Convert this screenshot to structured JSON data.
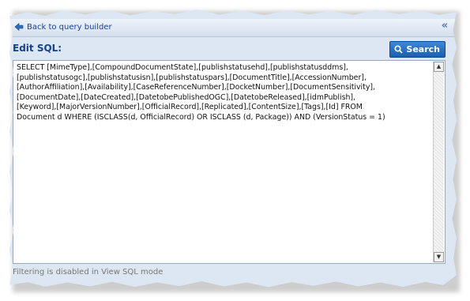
{
  "toolbar": {
    "back_label": "Back to query builder",
    "collapse_glyph": "«"
  },
  "editor": {
    "label": "Edit SQL:",
    "search_label": "Search",
    "sql": "SELECT [MimeType],[CompoundDocumentState],[publishstatusehd],[publishstatusddms],\n[publishstatusogc],[publishstatusisn],[publishstatuspars],[DocumentTitle],[AccessionNumber],\n[AuthorAffiliation],[Availability],[CaseReferenceNumber],[DocketNumber],[DocumentSensitivity],\n[DocumentDate],[DateCreated],[DatetobePublishedOGC],[DatetobeReleased],[idmPublish],\n[Keyword],[MajorVersionNumber],[OfficialRecord],[Replicated],[ContentSize],[Tags],[Id] FROM\nDocument d WHERE (ISCLASS(d, OfficialRecord) OR ISCLASS (d, Package)) AND (VersionStatus = 1)"
  },
  "status": {
    "message": "Filtering is disabled in View SQL mode"
  },
  "icons": {
    "back": "back-arrow-icon",
    "search": "magnifier-icon",
    "collapse": "double-chevron-left-icon"
  },
  "colors": {
    "accent": "#15428b",
    "button": "#1a5fb0",
    "panel": "#dde6f3"
  }
}
